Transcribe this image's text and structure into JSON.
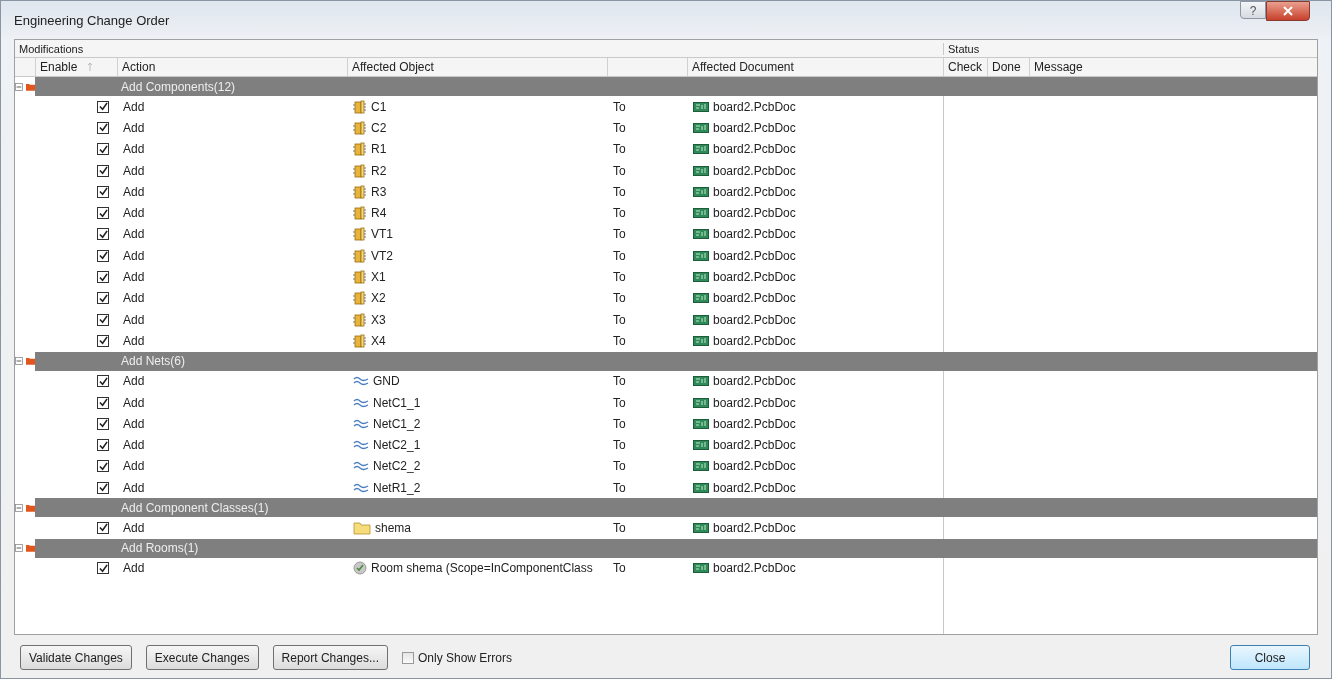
{
  "window": {
    "title": "Engineering Change Order",
    "help_button": "?"
  },
  "table": {
    "section_headers": [
      {
        "label": "Modifications"
      },
      {
        "label": "Status"
      }
    ],
    "columns": [
      {
        "label": "Enable"
      },
      {
        "label": "Action"
      },
      {
        "label": "Affected Object"
      },
      {
        "label": "Affected Document"
      },
      {
        "label": "Check"
      },
      {
        "label": "Done"
      },
      {
        "label": "Message"
      }
    ],
    "groups": [
      {
        "label": "Add Components(12)",
        "expanded": true,
        "items": [
          {
            "enabled": true,
            "action": "Add",
            "kind": "component",
            "object": "C1",
            "to": "To",
            "document": "board2.PcbDoc"
          },
          {
            "enabled": true,
            "action": "Add",
            "kind": "component",
            "object": "C2",
            "to": "To",
            "document": "board2.PcbDoc"
          },
          {
            "enabled": true,
            "action": "Add",
            "kind": "component",
            "object": "R1",
            "to": "To",
            "document": "board2.PcbDoc"
          },
          {
            "enabled": true,
            "action": "Add",
            "kind": "component",
            "object": "R2",
            "to": "To",
            "document": "board2.PcbDoc"
          },
          {
            "enabled": true,
            "action": "Add",
            "kind": "component",
            "object": "R3",
            "to": "To",
            "document": "board2.PcbDoc"
          },
          {
            "enabled": true,
            "action": "Add",
            "kind": "component",
            "object": "R4",
            "to": "To",
            "document": "board2.PcbDoc"
          },
          {
            "enabled": true,
            "action": "Add",
            "kind": "component",
            "object": "VT1",
            "to": "To",
            "document": "board2.PcbDoc"
          },
          {
            "enabled": true,
            "action": "Add",
            "kind": "component",
            "object": "VT2",
            "to": "To",
            "document": "board2.PcbDoc"
          },
          {
            "enabled": true,
            "action": "Add",
            "kind": "component",
            "object": "X1",
            "to": "To",
            "document": "board2.PcbDoc"
          },
          {
            "enabled": true,
            "action": "Add",
            "kind": "component",
            "object": "X2",
            "to": "To",
            "document": "board2.PcbDoc"
          },
          {
            "enabled": true,
            "action": "Add",
            "kind": "component",
            "object": "X3",
            "to": "To",
            "document": "board2.PcbDoc"
          },
          {
            "enabled": true,
            "action": "Add",
            "kind": "component",
            "object": "X4",
            "to": "To",
            "document": "board2.PcbDoc"
          }
        ]
      },
      {
        "label": "Add Nets(6)",
        "expanded": true,
        "items": [
          {
            "enabled": true,
            "action": "Add",
            "kind": "net",
            "object": "GND",
            "to": "To",
            "document": "board2.PcbDoc"
          },
          {
            "enabled": true,
            "action": "Add",
            "kind": "net",
            "object": "NetC1_1",
            "to": "To",
            "document": "board2.PcbDoc"
          },
          {
            "enabled": true,
            "action": "Add",
            "kind": "net",
            "object": "NetC1_2",
            "to": "To",
            "document": "board2.PcbDoc"
          },
          {
            "enabled": true,
            "action": "Add",
            "kind": "net",
            "object": "NetC2_1",
            "to": "To",
            "document": "board2.PcbDoc"
          },
          {
            "enabled": true,
            "action": "Add",
            "kind": "net",
            "object": "NetC2_2",
            "to": "To",
            "document": "board2.PcbDoc"
          },
          {
            "enabled": true,
            "action": "Add",
            "kind": "net",
            "object": "NetR1_2",
            "to": "To",
            "document": "board2.PcbDoc"
          }
        ]
      },
      {
        "label": "Add Component Classes(1)",
        "expanded": true,
        "items": [
          {
            "enabled": true,
            "action": "Add",
            "kind": "class",
            "object": "shema",
            "to": "To",
            "document": "board2.PcbDoc"
          }
        ]
      },
      {
        "label": "Add Rooms(1)",
        "expanded": true,
        "items": [
          {
            "enabled": true,
            "action": "Add",
            "kind": "room",
            "object": "Room shema (Scope=InComponentClass",
            "to": "To",
            "document": "board2.PcbDoc"
          }
        ]
      }
    ]
  },
  "footer": {
    "buttons": [
      {
        "label": "Validate Changes"
      },
      {
        "label": "Execute Changes"
      },
      {
        "label": "Report Changes..."
      }
    ],
    "only_show_errors": {
      "label": "Only Show Errors",
      "checked": false
    },
    "close_button": "Close"
  }
}
